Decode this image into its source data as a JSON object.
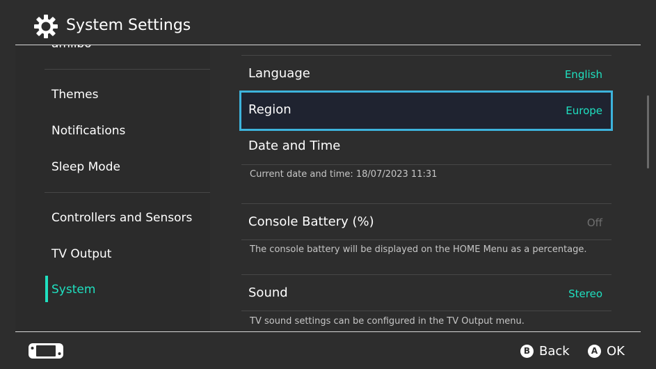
{
  "header": {
    "title": "System Settings",
    "icon": "gear-icon"
  },
  "sidebar": {
    "cut_item": "amiibo",
    "items": [
      {
        "label": "Themes"
      },
      {
        "label": "Notifications"
      },
      {
        "label": "Sleep Mode"
      },
      {
        "label": "Controllers and Sensors"
      },
      {
        "label": "TV Output"
      },
      {
        "label": "System",
        "selected": true
      }
    ]
  },
  "main": {
    "rows": [
      {
        "label": "Language",
        "value": "English"
      },
      {
        "label": "Region",
        "value": "Europe",
        "focused": true
      },
      {
        "label": "Date and Time",
        "value": "",
        "description": "Current date and time: 18/07/2023 11:31"
      },
      {
        "label": "Console Battery (%)",
        "value": "Off",
        "description": "The console battery will be displayed on the HOME Menu as a percentage."
      },
      {
        "label": "Sound",
        "value": "Stereo",
        "description": "TV sound settings can be configured in the TV Output menu."
      }
    ]
  },
  "footer": {
    "left_icon": "console-icon",
    "back": {
      "button": "B",
      "label": "Back"
    },
    "ok": {
      "button": "A",
      "label": "OK"
    }
  },
  "colors": {
    "accent": "#1fe0c0",
    "focus_border": "#3db3dc",
    "background": "#2d2d2d"
  }
}
